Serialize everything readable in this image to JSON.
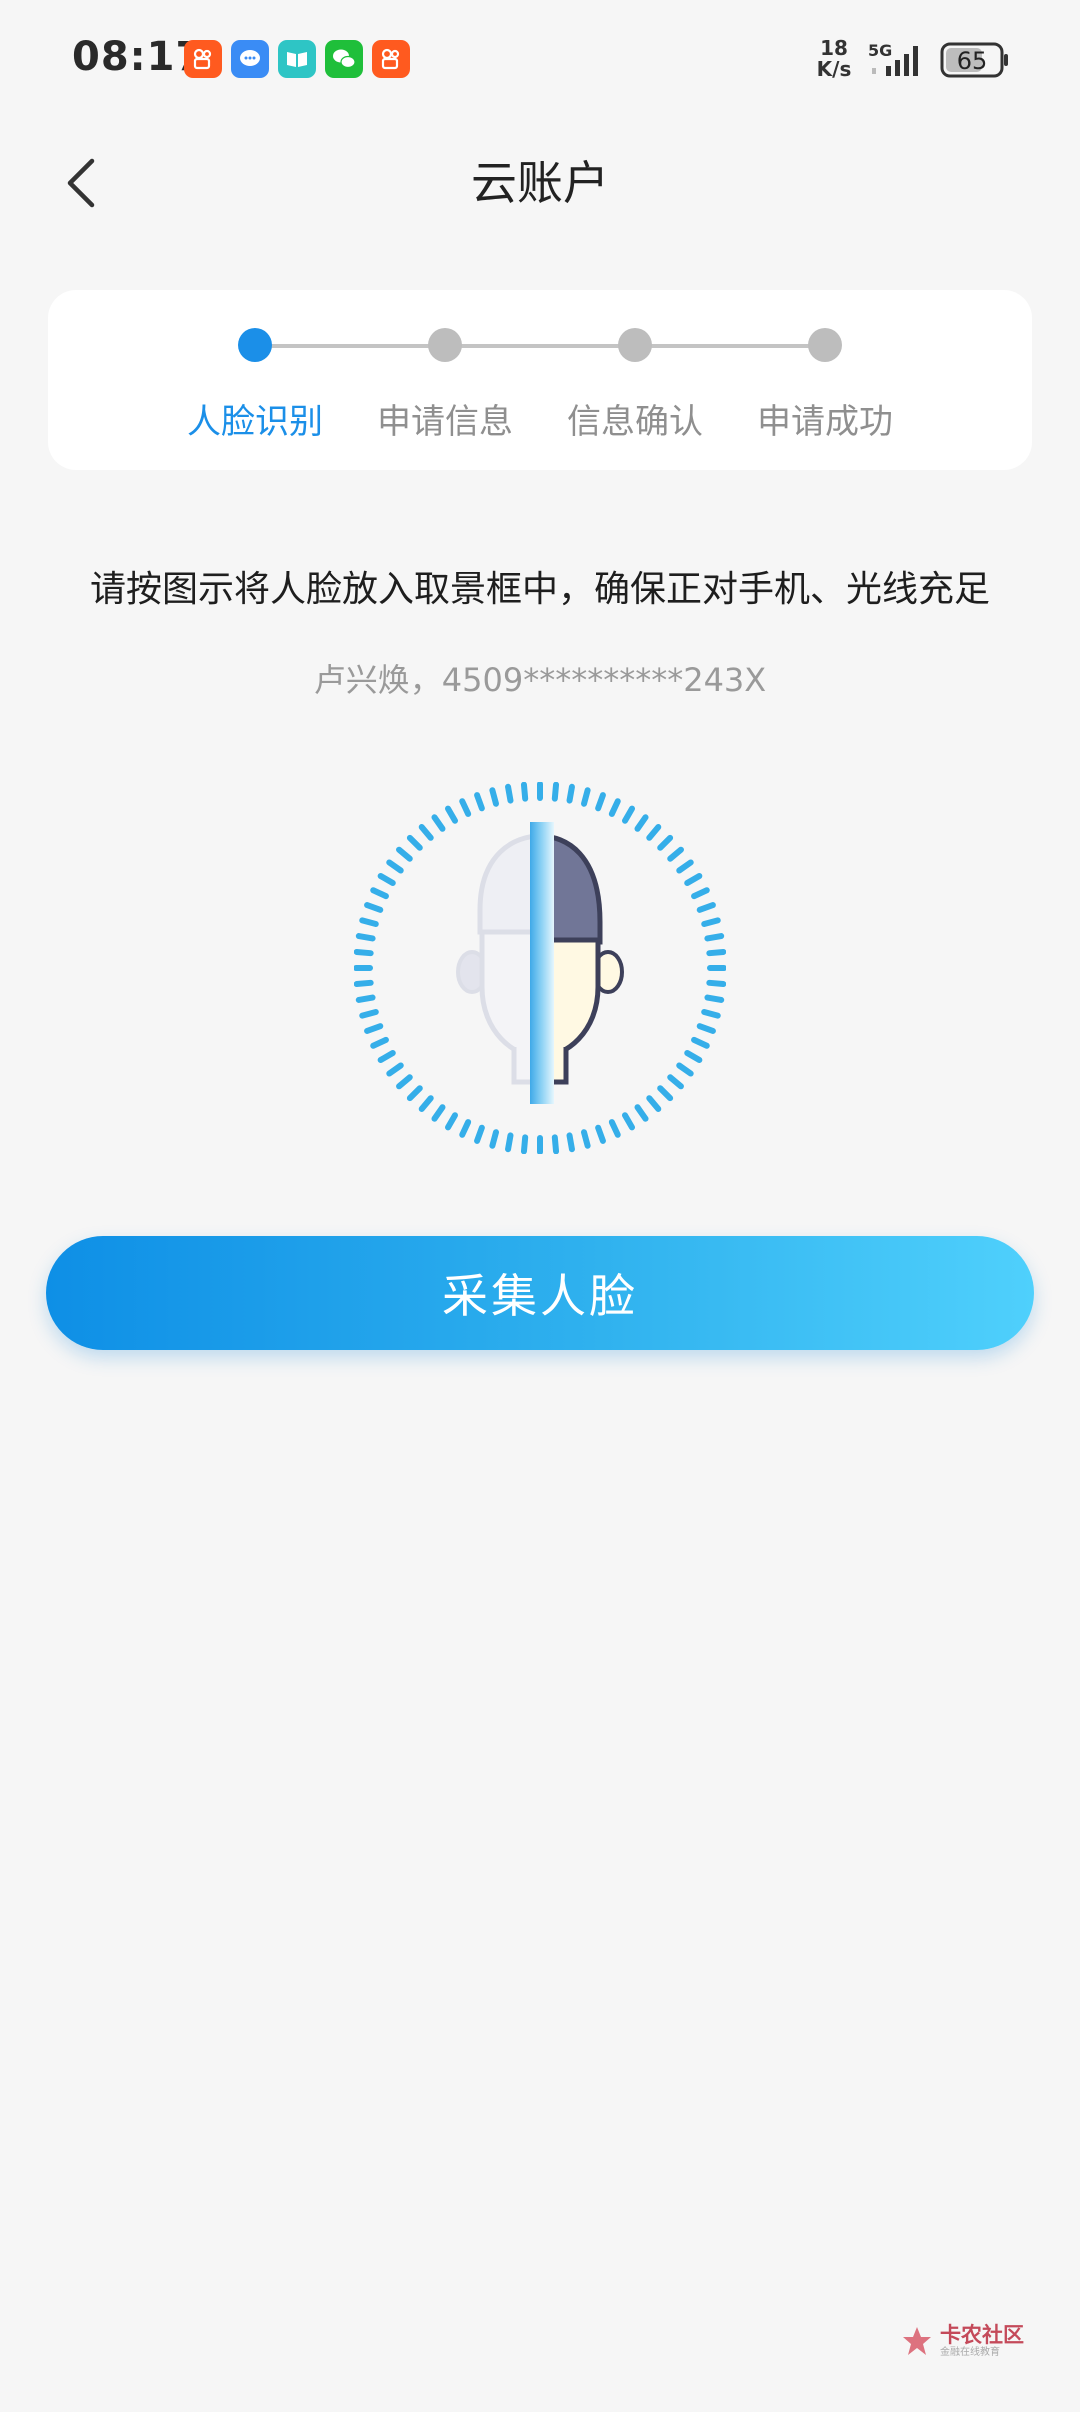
{
  "status_bar": {
    "time": "08:17",
    "net_speed_value": "18",
    "net_speed_unit": "K/s",
    "network_type": "5G",
    "battery_level": "65",
    "notification_icons": [
      "kuaishou-icon",
      "message-icon",
      "reader-icon",
      "wechat-icon",
      "kuaishou-icon"
    ]
  },
  "header": {
    "title": "云账户",
    "back_icon": "chevron-left-icon"
  },
  "steps": {
    "items": [
      {
        "label": "人脸识别",
        "active": true
      },
      {
        "label": "申请信息",
        "active": false
      },
      {
        "label": "信息确认",
        "active": false
      },
      {
        "label": "申请成功",
        "active": false
      }
    ],
    "active_color": "#1b8fe8",
    "inactive_color": "#bdbdbd"
  },
  "instruction": "请按图示将人脸放入取景框中，确保正对手机、光线充足",
  "id_info": "卢兴焕，4509**********243X",
  "face_illustration": {
    "icon": "face-scan-icon",
    "ring_color": "#35aee9"
  },
  "capture_button": {
    "label": "采集人脸"
  },
  "watermark": {
    "title": "卡农社区",
    "subtitle": "金融在线教育"
  }
}
